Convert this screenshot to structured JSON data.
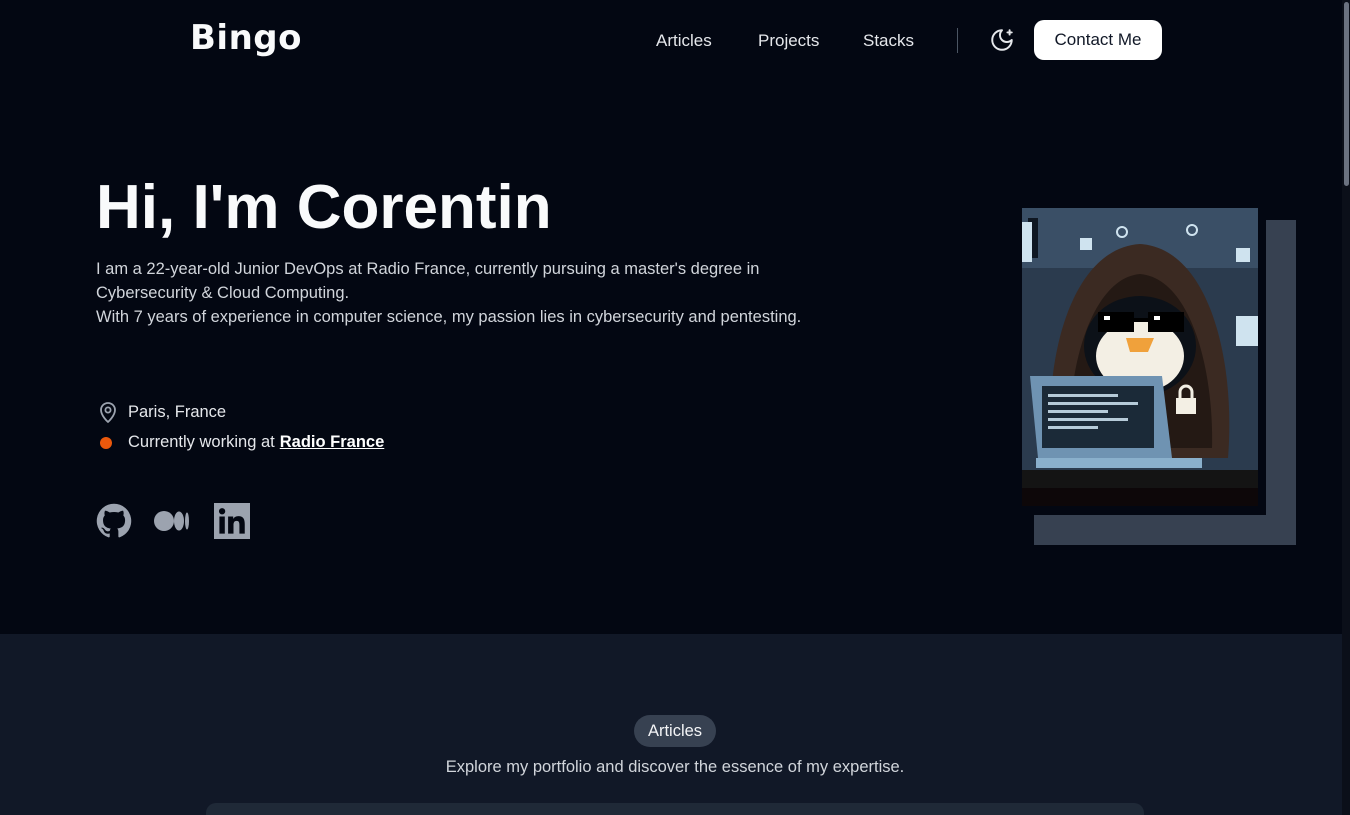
{
  "header": {
    "logo": "Bingo",
    "nav": [
      {
        "label": "Articles"
      },
      {
        "label": "Projects"
      },
      {
        "label": "Stacks"
      }
    ],
    "theme_icon": "moon-icon",
    "contact_label": "Contact Me"
  },
  "hero": {
    "title": "Hi, I'm Corentin",
    "description_lines": [
      "I am a 22-year-old Junior DevOps at Radio France, currently pursuing a master's degree in Cybersecurity & Cloud Computing.",
      "With 7 years of experience in computer science, my passion lies in cybersecurity and pentesting."
    ],
    "location": "Paris, France",
    "location_icon": "map-pin-icon",
    "work_prefix": "Currently working at",
    "work_company": "Radio France",
    "status_color": "#ea580c",
    "socials": [
      {
        "name": "github-icon"
      },
      {
        "name": "medium-icon"
      },
      {
        "name": "linkedin-icon"
      }
    ],
    "avatar": "hooded-penguin-hacker-illustration"
  },
  "articles": {
    "badge": "Articles",
    "subtitle": "Explore my portfolio and discover the essence of my expertise."
  },
  "colors": {
    "background": "#030712",
    "section_background": "#111827",
    "accent": "#ffffff",
    "image_shadow": "#374151"
  }
}
